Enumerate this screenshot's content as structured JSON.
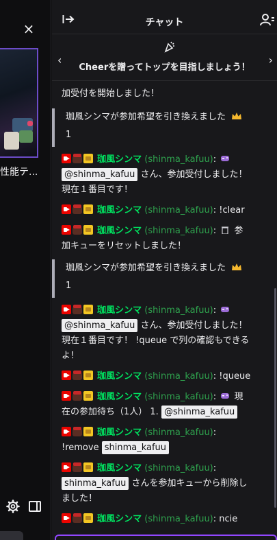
{
  "video": {
    "close_label": "×",
    "stream_title_fragment": "性能テ..."
  },
  "chat": {
    "title": "チャット",
    "cheer_banner": "Cheerを贈ってトップを目指しましょう！",
    "prev_arrow": "‹",
    "next_arrow": "›"
  },
  "messages": [
    {
      "kind": "continuation",
      "text": "加受付を開始しました！"
    },
    {
      "kind": "system",
      "text": "珈風シンマが参加希望を引き換えました",
      "amount": "1"
    },
    {
      "kind": "chat",
      "user": "珈風シンマ",
      "login": "(shinma_kafuu)",
      "sep": ":",
      "mention": "@shinma_kafuu",
      "text_a": "さん、参加受付しました！",
      "text_b": "現在１番目です！"
    },
    {
      "kind": "chat",
      "user": "珈風シンマ",
      "login": "(shinma_kafuu)",
      "sep": ":",
      "text": "!clear"
    },
    {
      "kind": "chat",
      "user": "珈風シンマ",
      "login": "(shinma_kafuu)",
      "sep": ":",
      "text_a": "参",
      "text_b": "加キューをリセットしました！"
    },
    {
      "kind": "system",
      "text": "珈風シンマが参加希望を引き換えました",
      "amount": "1"
    },
    {
      "kind": "chat",
      "user": "珈風シンマ",
      "login": "(shinma_kafuu)",
      "sep": ":",
      "mention": "@shinma_kafuu",
      "text_a": "さん、参加受付しました！",
      "text_b": "現在１番目です！ !queue で列の確認もできる",
      "text_c": "よ！"
    },
    {
      "kind": "chat",
      "user": "珈風シンマ",
      "login": "(shinma_kafuu)",
      "sep": ":",
      "text": "!queue"
    },
    {
      "kind": "chat",
      "user": "珈風シンマ",
      "login": "(shinma_kafuu)",
      "sep": ":",
      "text_a": "現",
      "text_b": "在の参加待ち（1人） 1.",
      "mention": "@shinma_kafuu"
    },
    {
      "kind": "chat",
      "user": "珈風シンマ",
      "login": "(shinma_kafuu)",
      "sep": ":",
      "text_b": "!remove",
      "mention": "shinma_kafuu"
    },
    {
      "kind": "chat",
      "user": "珈風シンマ",
      "login": "(shinma_kafuu)",
      "sep": ":",
      "mention": "shinma_kafuu",
      "text_b": "さんを参加キューから削除し",
      "text_c": "ました！"
    },
    {
      "kind": "chat",
      "user": "珈風シンマ",
      "login": "(shinma_kafuu)",
      "sep": ":",
      "text": "ncie"
    }
  ],
  "colors": {
    "username": "#00e05f",
    "login": "#2fa24e",
    "accent": "#9147ff",
    "background": "#18181b"
  },
  "icons": [
    "close-icon",
    "gear-icon",
    "panel-icon",
    "collapse-chat-icon",
    "community-icon",
    "party-popper-icon",
    "broadcaster-badge-icon",
    "moderator-badge-icon",
    "subscriber-badge-icon",
    "gamepad-emote-icon",
    "trash-emote-icon",
    "crown-icon"
  ]
}
